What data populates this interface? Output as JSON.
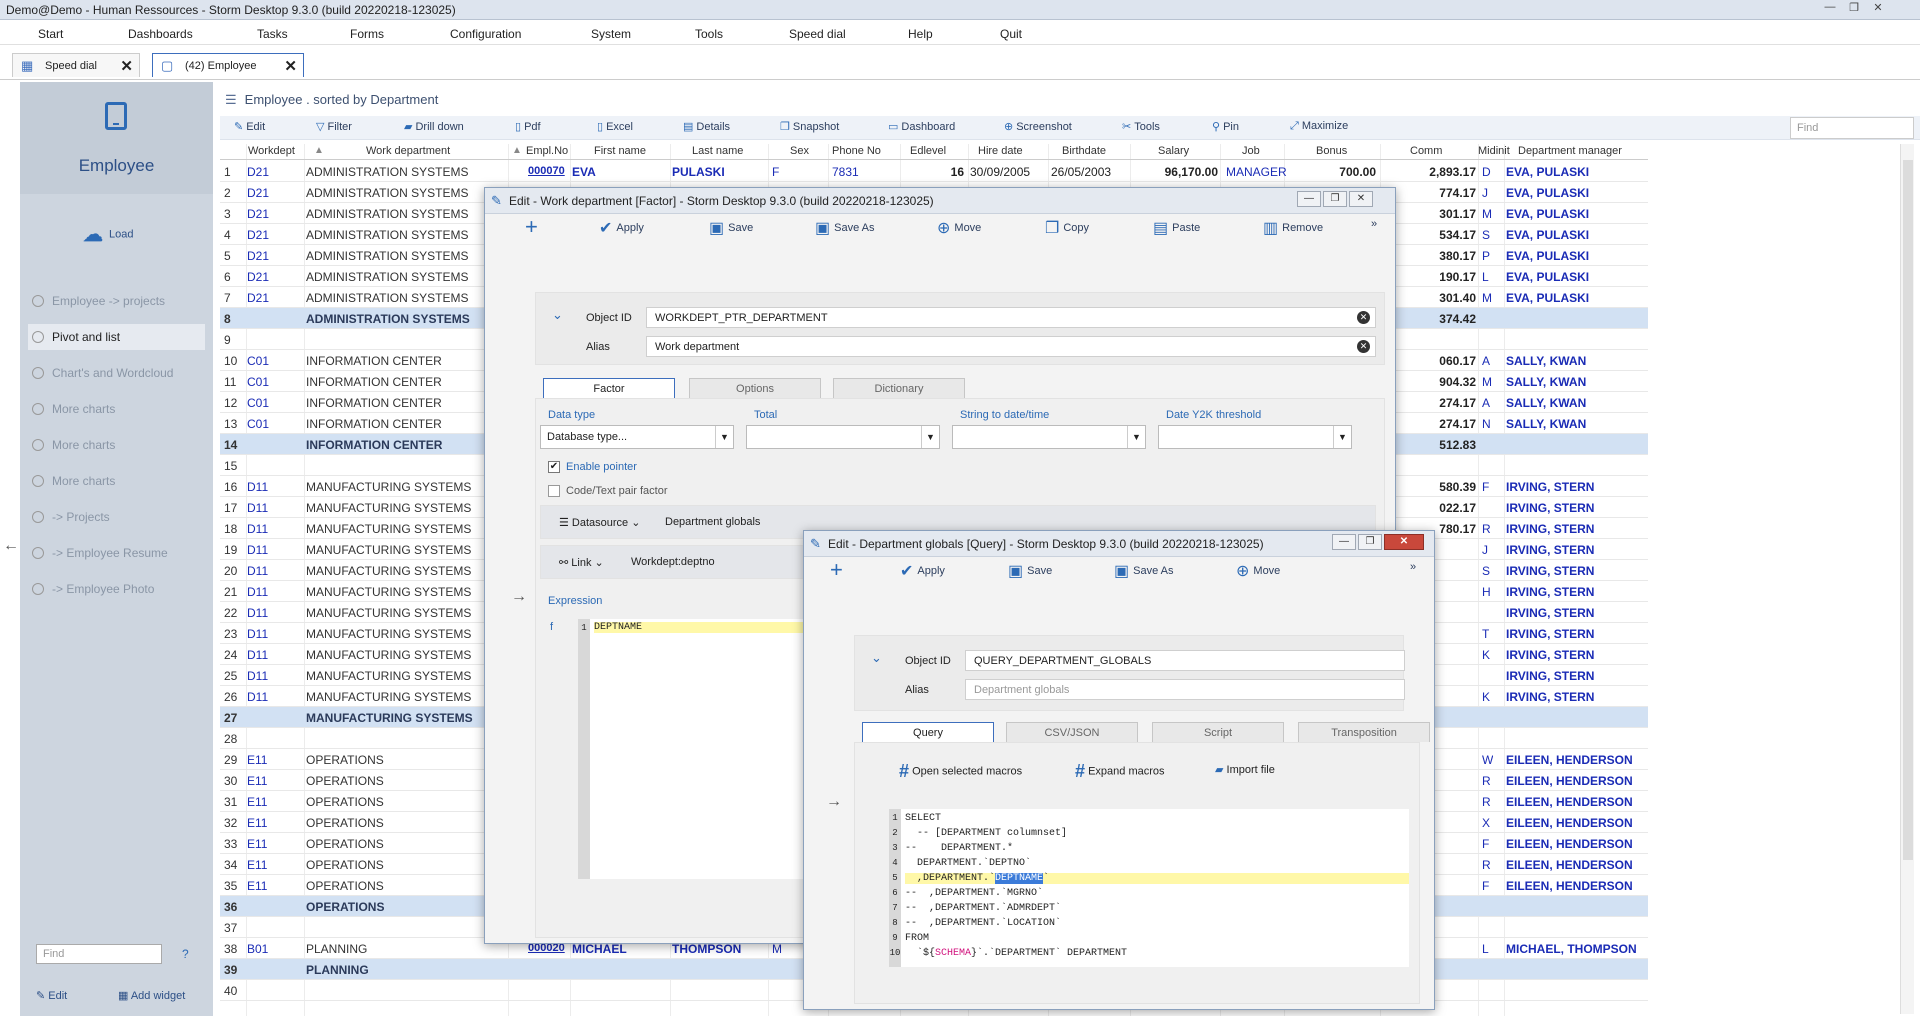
{
  "window": {
    "title": "Demo@Demo - Human Ressources - Storm Desktop 9.3.0 (build 20220218-123025)"
  },
  "menu": [
    "Start",
    "Dashboards",
    "Tasks",
    "Forms",
    "Configuration",
    "System",
    "Tools",
    "Speed dial",
    "Help",
    "Quit"
  ],
  "tabs": [
    {
      "label": "Speed dial",
      "icon": "grid-icon"
    },
    {
      "label": "(42) Employee",
      "icon": "tablet-icon"
    }
  ],
  "sidebar": {
    "title": "Employee",
    "load": "Load",
    "items": [
      "Employee -> projects",
      "Pivot and list",
      "Chart's and Wordcloud",
      "More charts",
      "More charts",
      "More charts",
      "-> Projects",
      "-> Employee Resume",
      "-> Employee Photo"
    ],
    "selected_index": 1,
    "find_placeholder": "Find",
    "help": "?",
    "edit": "Edit",
    "add_widget": "Add widget"
  },
  "main": {
    "title": "Employee . sorted by Department",
    "find_placeholder": "Find",
    "toolbar": [
      "Edit",
      "Filter",
      "Drill down",
      "Pdf",
      "Excel",
      "Details",
      "Snapshot",
      "Dashboard",
      "Screenshot",
      "Tools",
      "Pin",
      "Maximize"
    ],
    "columns": [
      "Workdept",
      "Work department",
      "Empl.No",
      "First name",
      "Last name",
      "Sex",
      "Phone No",
      "Edlevel",
      "Hire date",
      "Birthdate",
      "Salary",
      "Job",
      "Bonus",
      "Comm",
      "Midinit",
      "Department manager"
    ],
    "rows": [
      {
        "n": "1",
        "wd": "D21",
        "dep": "ADMINISTRATION SYSTEMS",
        "emp": "000070",
        "fn": "EVA",
        "ln": "PULASKI",
        "sx": "F",
        "ph": "7831",
        "ed": "16",
        "hd": "30/09/2005",
        "bd": "26/05/2003",
        "sal": "96,170.00",
        "job": "MANAGER",
        "bon": "700.00",
        "com": "2,893.17",
        "mi": "D",
        "mgr": "EVA, PULASKI"
      },
      {
        "n": "2",
        "wd": "D21",
        "dep": "ADMINISTRATION SYSTEMS",
        "com": "774.17",
        "mi": "J",
        "mgr": "EVA, PULASKI"
      },
      {
        "n": "3",
        "wd": "D21",
        "dep": "ADMINISTRATION SYSTEMS",
        "com": "301.17",
        "mi": "M",
        "mgr": "EVA, PULASKI"
      },
      {
        "n": "4",
        "wd": "D21",
        "dep": "ADMINISTRATION SYSTEMS",
        "com": "534.17",
        "mi": "S",
        "mgr": "EVA, PULASKI"
      },
      {
        "n": "5",
        "wd": "D21",
        "dep": "ADMINISTRATION SYSTEMS",
        "com": "380.17",
        "mi": "P",
        "mgr": "EVA, PULASKI"
      },
      {
        "n": "6",
        "wd": "D21",
        "dep": "ADMINISTRATION SYSTEMS",
        "com": "190.17",
        "mi": "L",
        "mgr": "EVA, PULASKI"
      },
      {
        "n": "7",
        "wd": "D21",
        "dep": "ADMINISTRATION SYSTEMS",
        "com": "301.40",
        "mi": "M",
        "mgr": "EVA, PULASKI"
      },
      {
        "n": "8",
        "grp": true,
        "dep": "ADMINISTRATION SYSTEMS",
        "com": "374.42"
      },
      {
        "n": "9"
      },
      {
        "n": "10",
        "wd": "C01",
        "dep": "INFORMATION CENTER",
        "com": "060.17",
        "mi": "A",
        "mgr": "SALLY, KWAN"
      },
      {
        "n": "11",
        "wd": "C01",
        "dep": "INFORMATION CENTER",
        "com": "904.32",
        "mi": "M",
        "mgr": "SALLY, KWAN"
      },
      {
        "n": "12",
        "wd": "C01",
        "dep": "INFORMATION CENTER",
        "com": "274.17",
        "mi": "A",
        "mgr": "SALLY, KWAN"
      },
      {
        "n": "13",
        "wd": "C01",
        "dep": "INFORMATION CENTER",
        "com": "274.17",
        "mi": "N",
        "mgr": "SALLY, KWAN"
      },
      {
        "n": "14",
        "grp": true,
        "dep": "INFORMATION CENTER",
        "com": "512.83"
      },
      {
        "n": "15"
      },
      {
        "n": "16",
        "wd": "D11",
        "dep": "MANUFACTURING SYSTEMS",
        "com": "580.39",
        "mi": "F",
        "mgr": "IRVING, STERN"
      },
      {
        "n": "17",
        "wd": "D11",
        "dep": "MANUFACTURING SYSTEMS",
        "com": "022.17",
        "mgr": "IRVING, STERN"
      },
      {
        "n": "18",
        "wd": "D11",
        "dep": "MANUFACTURING SYSTEMS",
        "com": "780.17",
        "mi": "R",
        "mgr": "IRVING, STERN"
      },
      {
        "n": "19",
        "wd": "D11",
        "dep": "MANUFACTURING SYSTEMS",
        "mi": "J",
        "mgr": "IRVING, STERN"
      },
      {
        "n": "20",
        "wd": "D11",
        "dep": "MANUFACTURING SYSTEMS",
        "mi": "S",
        "mgr": "IRVING, STERN"
      },
      {
        "n": "21",
        "wd": "D11",
        "dep": "MANUFACTURING SYSTEMS",
        "mi": "H",
        "mgr": "IRVING, STERN"
      },
      {
        "n": "22",
        "wd": "D11",
        "dep": "MANUFACTURING SYSTEMS",
        "mgr": "IRVING, STERN"
      },
      {
        "n": "23",
        "wd": "D11",
        "dep": "MANUFACTURING SYSTEMS",
        "mi": "T",
        "mgr": "IRVING, STERN"
      },
      {
        "n": "24",
        "wd": "D11",
        "dep": "MANUFACTURING SYSTEMS",
        "mi": "K",
        "mgr": "IRVING, STERN"
      },
      {
        "n": "25",
        "wd": "D11",
        "dep": "MANUFACTURING SYSTEMS",
        "mgr": "IRVING, STERN"
      },
      {
        "n": "26",
        "wd": "D11",
        "dep": "MANUFACTURING SYSTEMS",
        "mi": "K",
        "mgr": "IRVING, STERN"
      },
      {
        "n": "27",
        "grp": true,
        "dep": "MANUFACTURING SYSTEMS"
      },
      {
        "n": "28"
      },
      {
        "n": "29",
        "wd": "E11",
        "dep": "OPERATIONS",
        "mi": "W",
        "mgr": "EILEEN, HENDERSON"
      },
      {
        "n": "30",
        "wd": "E11",
        "dep": "OPERATIONS",
        "mi": "R",
        "mgr": "EILEEN, HENDERSON"
      },
      {
        "n": "31",
        "wd": "E11",
        "dep": "OPERATIONS",
        "mi": "R",
        "mgr": "EILEEN, HENDERSON"
      },
      {
        "n": "32",
        "wd": "E11",
        "dep": "OPERATIONS",
        "mi": "X",
        "mgr": "EILEEN, HENDERSON"
      },
      {
        "n": "33",
        "wd": "E11",
        "dep": "OPERATIONS",
        "mi": "F",
        "mgr": "EILEEN, HENDERSON"
      },
      {
        "n": "34",
        "wd": "E11",
        "dep": "OPERATIONS",
        "mi": "R",
        "mgr": "EILEEN, HENDERSON"
      },
      {
        "n": "35",
        "wd": "E11",
        "dep": "OPERATIONS",
        "mi": "F",
        "mgr": "EILEEN, HENDERSON"
      },
      {
        "n": "36",
        "grp": true,
        "dep": "OPERATIONS"
      },
      {
        "n": "37"
      },
      {
        "n": "38",
        "wd": "B01",
        "dep": "PLANNING",
        "emp": "000020",
        "fn": "MICHAEL",
        "ln": "THOMPSON",
        "sx": "M",
        "mi": "L",
        "mgr": "MICHAEL, THOMPSON"
      },
      {
        "n": "39",
        "grp": true,
        "dep": "PLANNING"
      },
      {
        "n": "40"
      }
    ]
  },
  "dialog1": {
    "title": "Edit - Work department [Factor] - Storm Desktop 9.3.0 (build 20220218-123025)",
    "toolbar": [
      "Apply",
      "Save",
      "Save As",
      "Move",
      "Copy",
      "Paste",
      "Remove"
    ],
    "object_id_label": "Object ID",
    "object_id": "WORKDEPT_PTR_DEPARTMENT",
    "alias_label": "Alias",
    "alias": "Work department",
    "tabs": [
      "Factor",
      "Options",
      "Dictionary"
    ],
    "fields": {
      "data_type": "Data type",
      "data_type_value": "Database type...",
      "total": "Total",
      "string_to_date": "String to date/time",
      "y2k": "Date Y2K threshold"
    },
    "enable_pointer": "Enable pointer",
    "code_text": "Code/Text pair factor",
    "datasource_label": "Datasource",
    "datasource": "Department globals",
    "link_label": "Link",
    "link": "Workdept:deptno",
    "expression_label": "Expression",
    "expression": "DEPTNAME",
    "fx": "f"
  },
  "dialog2": {
    "title": "Edit - Department globals [Query] - Storm Desktop 9.3.0 (build 20220218-123025)",
    "toolbar": [
      "Apply",
      "Save",
      "Save As",
      "Move"
    ],
    "object_id_label": "Object ID",
    "object_id": "QUERY_DEPARTMENT_GLOBALS",
    "alias_label": "Alias",
    "alias_placeholder": "Department globals",
    "tabs": [
      "Query",
      "CSV/JSON",
      "Script",
      "Transposition"
    ],
    "actions": [
      "Open selected macros",
      "Expand macros",
      "Import file"
    ]
  }
}
